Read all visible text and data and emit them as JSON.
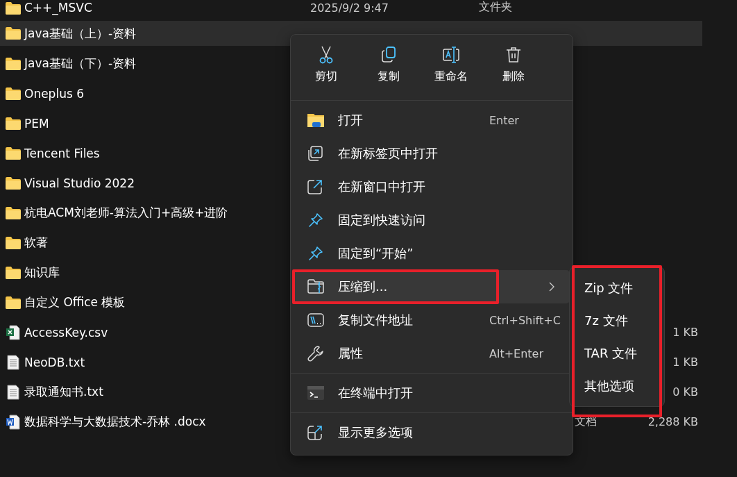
{
  "files": [
    {
      "kind": "folder",
      "name": "C++_MSVC",
      "date": "2025/9/2 9:47",
      "type": "文件夹",
      "selected": false
    },
    {
      "kind": "folder",
      "name": "Java基础（上）-资料",
      "selected": true
    },
    {
      "kind": "folder",
      "name": "Java基础（下）-资料",
      "selected": false
    },
    {
      "kind": "folder",
      "name": "Oneplus 6",
      "selected": false
    },
    {
      "kind": "folder",
      "name": "PEM",
      "selected": false
    },
    {
      "kind": "folder",
      "name": "Tencent Files",
      "selected": false
    },
    {
      "kind": "folder",
      "name": "Visual Studio 2022",
      "selected": false
    },
    {
      "kind": "folder",
      "name": "杭电ACM刘老师-算法入门+高级+进阶",
      "selected": false
    },
    {
      "kind": "folder",
      "name": "软著",
      "selected": false
    },
    {
      "kind": "folder",
      "name": "知识库",
      "selected": false
    },
    {
      "kind": "folder",
      "name": "自定义 Office 模板",
      "selected": false
    },
    {
      "kind": "excel",
      "name": "AccessKey.csv",
      "size": "1 KB",
      "selected": false
    },
    {
      "kind": "text",
      "name": "NeoDB.txt",
      "size": "1 KB",
      "selected": false
    },
    {
      "kind": "text",
      "name": "录取通知书.txt",
      "size": "0 KB",
      "selected": false
    },
    {
      "kind": "word",
      "name": "数据科学与大数据技术-乔林 .docx",
      "type": "文档",
      "size": "2,288 KB",
      "selected": false
    }
  ],
  "context_menu": {
    "toolbar": [
      {
        "kind": "cut",
        "label": "剪切"
      },
      {
        "kind": "copy",
        "label": "复制"
      },
      {
        "kind": "rename",
        "label": "重命名"
      },
      {
        "kind": "delete",
        "label": "删除"
      }
    ],
    "sections": [
      [
        {
          "kind": "open",
          "label": "打开",
          "shortcut": "Enter",
          "submenu": false,
          "selected": false
        },
        {
          "kind": "new-tab",
          "label": "在新标签页中打开",
          "submenu": false,
          "selected": false
        },
        {
          "kind": "new-window",
          "label": "在新窗口中打开",
          "submenu": false,
          "selected": false
        },
        {
          "kind": "pin",
          "label": "固定到快速访问",
          "submenu": false,
          "selected": false
        },
        {
          "kind": "pin",
          "label": "固定到“开始”",
          "submenu": false,
          "selected": false
        },
        {
          "kind": "zip",
          "label": "压缩到...",
          "submenu": true,
          "selected": true
        },
        {
          "kind": "path",
          "label": "复制文件地址",
          "shortcut": "Ctrl+Shift+C",
          "submenu": false,
          "selected": false
        },
        {
          "kind": "wrench",
          "label": "属性",
          "shortcut": "Alt+Enter",
          "submenu": false,
          "selected": false
        }
      ],
      [
        {
          "kind": "terminal",
          "label": "在终端中打开",
          "submenu": false,
          "selected": false
        }
      ],
      [
        {
          "kind": "more",
          "label": "显示更多选项",
          "submenu": false,
          "selected": false
        }
      ]
    ]
  },
  "submenu": {
    "items": [
      {
        "label": "Zip 文件"
      },
      {
        "label": "7z 文件"
      },
      {
        "label": "TAR 文件"
      },
      {
        "label": "其他选项"
      }
    ]
  }
}
